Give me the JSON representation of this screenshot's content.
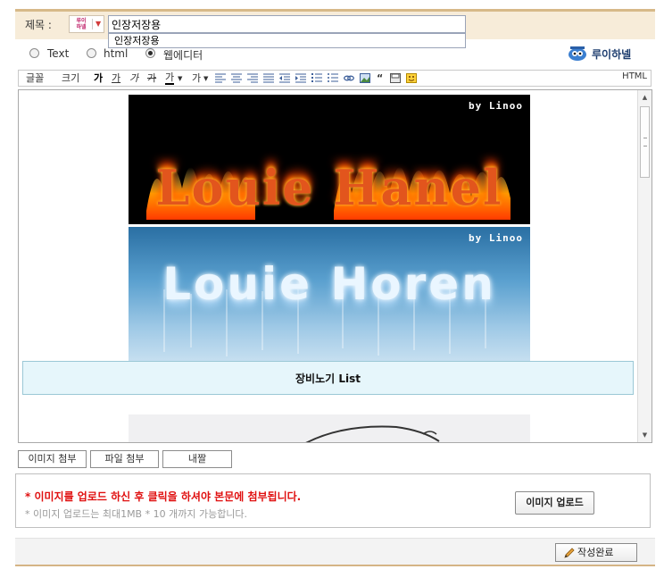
{
  "title_bar": {
    "label": "제목 :",
    "badge_text": "루이\n하넬",
    "title_value": "인장저장용",
    "suggestion": "인장저장용"
  },
  "mode": {
    "options": [
      {
        "label": "Text",
        "selected": false
      },
      {
        "label": "html",
        "selected": false
      },
      {
        "label": "웹에디터",
        "selected": true
      }
    ],
    "brand_name": "루이하넬"
  },
  "toolbar": {
    "font_label": "글꼴",
    "size_label": "크기",
    "bold": "가",
    "underline": "가",
    "italic": "가",
    "strike": "가",
    "text_color": "가",
    "bg_color": "가",
    "html_label": "HTML"
  },
  "editor": {
    "fire_byline": "by Linoo",
    "fire_title": "Louie Hanel",
    "ice_byline": "by Linoo",
    "ice_title": "Louie Horen",
    "list_title": "장비노기 List"
  },
  "attach_tabs": [
    "이미지 첨부",
    "파일 첨부",
    "내짤"
  ],
  "upload": {
    "warning": "* 이미지를 업로드 하신 후 클릭을 하셔야 본문에 첨부됩니다.",
    "note": "* 이미지 업로드는 최대1MB * 10 개까지 가능합니다.",
    "button_label": "이미지 업로드"
  },
  "footer": {
    "submit_label": "작성완료"
  },
  "colors": {
    "accent_border": "#d7b989",
    "title_bg": "#f7ecd9",
    "warning_red": "#e01010",
    "list_bg": "#e6f6fb"
  }
}
